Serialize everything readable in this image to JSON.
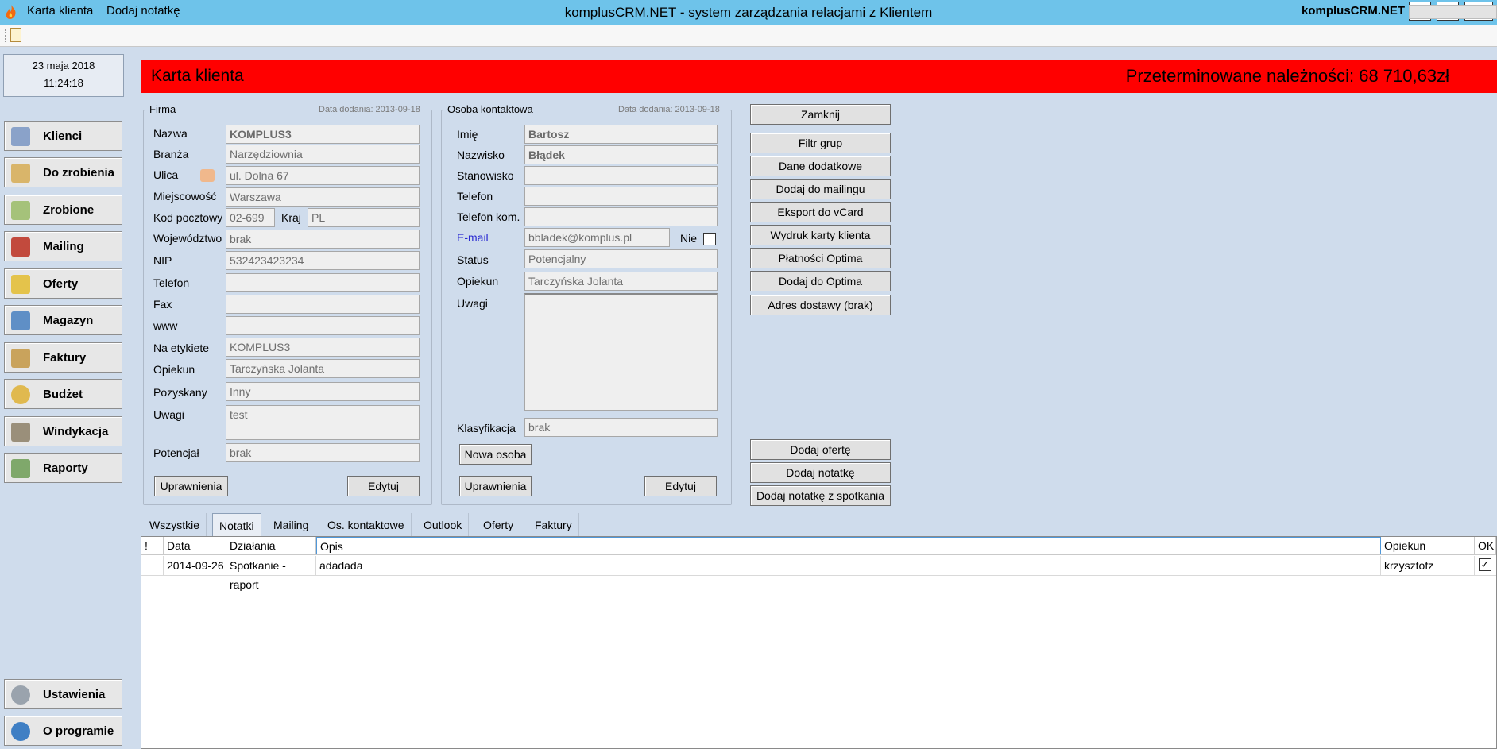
{
  "window": {
    "title": "komplusCRM.NET - system zarządzania relacjami z Klientem",
    "controls": {
      "minimize": "–",
      "restore": "❐",
      "close": "✕"
    }
  },
  "toolbar": {
    "items": [
      "Karta klienta",
      "Dodaj notatkę"
    ],
    "brand": "komplusCRM.NET"
  },
  "datetime": {
    "date": "23 maja 2018",
    "time": "11:24:18"
  },
  "nav": {
    "items": [
      {
        "label": "Klienci",
        "icon": "person-icon"
      },
      {
        "label": "Do zrobienia",
        "icon": "clipboard-icon"
      },
      {
        "label": "Zrobione",
        "icon": "clipboard-check-icon"
      },
      {
        "label": "Mailing",
        "icon": "mail-icon"
      },
      {
        "label": "Oferty",
        "icon": "folder-icon"
      },
      {
        "label": "Magazyn",
        "icon": "warehouse-icon"
      },
      {
        "label": "Faktury",
        "icon": "invoice-icon"
      },
      {
        "label": "Budżet",
        "icon": "money-bag-icon"
      },
      {
        "label": "Windykacja",
        "icon": "collection-icon"
      },
      {
        "label": "Raporty",
        "icon": "report-icon"
      }
    ],
    "bottom": [
      {
        "label": "Ustawienia",
        "icon": "settings-icon"
      },
      {
        "label": "O programie",
        "icon": "info-icon"
      }
    ]
  },
  "header": {
    "title": "Karta klienta",
    "overdue": "Przeterminowane należności: 68 710,63zł",
    "color": "#ff0000"
  },
  "firma": {
    "legend": "Firma",
    "date_added": "Data dodania: 2013-09-18",
    "labels": {
      "nazwa": "Nazwa",
      "branza": "Branża",
      "ulica": "Ulica",
      "miejscowosc": "Miejscowość",
      "kod": "Kod pocztowy",
      "kraj": "Kraj",
      "wojewodztwo": "Województwo",
      "nip": "NIP",
      "telefon": "Telefon",
      "fax": "Fax",
      "www": "www",
      "na_etykiete": "Na etykiete",
      "opiekun": "Opiekun",
      "pozyskany": "Pozyskany",
      "uwagi": "Uwagi",
      "potencjal": "Potencjał"
    },
    "values": {
      "nazwa": "KOMPLUS3",
      "branza": "Narzędziownia",
      "ulica": "ul. Dolna 67",
      "miejscowosc": "Warszawa",
      "kod": "02-699",
      "kraj": "PL",
      "wojewodztwo": "brak",
      "nip": "532423423234",
      "telefon": "",
      "fax": "",
      "www": "",
      "na_etykiete": "KOMPLUS3",
      "opiekun": "Tarczyńska Jolanta",
      "pozyskany": "Inny",
      "uwagi": "test",
      "potencjal": "brak"
    },
    "buttons": {
      "uprawnienia": "Uprawnienia",
      "edytuj": "Edytuj"
    }
  },
  "osoba": {
    "legend": "Osoba kontaktowa",
    "date_added": "Data dodania: 2013-09-18",
    "labels": {
      "imie": "Imię",
      "nazwisko": "Nazwisko",
      "stanowisko": "Stanowisko",
      "telefon": "Telefon",
      "telefon_kom": "Telefon kom.",
      "email": "E-mail",
      "nie": "Nie",
      "status": "Status",
      "opiekun": "Opiekun",
      "uwagi": "Uwagi",
      "klasyfikacja": "Klasyfikacja"
    },
    "values": {
      "imie": "Bartosz",
      "nazwisko": "Błądek",
      "stanowisko": "",
      "telefon": "",
      "telefon_kom": "",
      "email": "bbladek@komplus.pl",
      "status": "Potencjalny",
      "opiekun": "Tarczyńska Jolanta",
      "uwagi": "",
      "klasyfikacja": "brak"
    },
    "buttons": {
      "nowa_osoba": "Nowa osoba",
      "uprawnienia": "Uprawnienia",
      "edytuj": "Edytuj"
    }
  },
  "actions": {
    "top": [
      "Zamknij",
      "Filtr grup",
      "Dane dodatkowe",
      "Dodaj do mailingu",
      "Eksport do vCard",
      "Wydruk karty klienta",
      "Płatności Optima",
      "Dodaj do Optima",
      "Adres dostawy (brak)"
    ],
    "bottom": [
      "Dodaj ofertę",
      "Dodaj notatkę",
      "Dodaj notatkę z spotkania"
    ]
  },
  "tabs": [
    "Wszystkie",
    "Notatki",
    "Mailing",
    "Os. kontaktowe",
    "Outlook",
    "Oferty",
    "Faktury"
  ],
  "active_tab": "Notatki",
  "grid": {
    "columns": [
      "!",
      "Data",
      "Działania",
      "Opis",
      "Opiekun",
      "OK"
    ],
    "rows": [
      {
        "flag": "",
        "data": "2014-09-26",
        "dzialania": "Spotkanie - raport",
        "opis": "adadada",
        "opiekun": "krzysztofz",
        "ok": "✓"
      }
    ]
  }
}
